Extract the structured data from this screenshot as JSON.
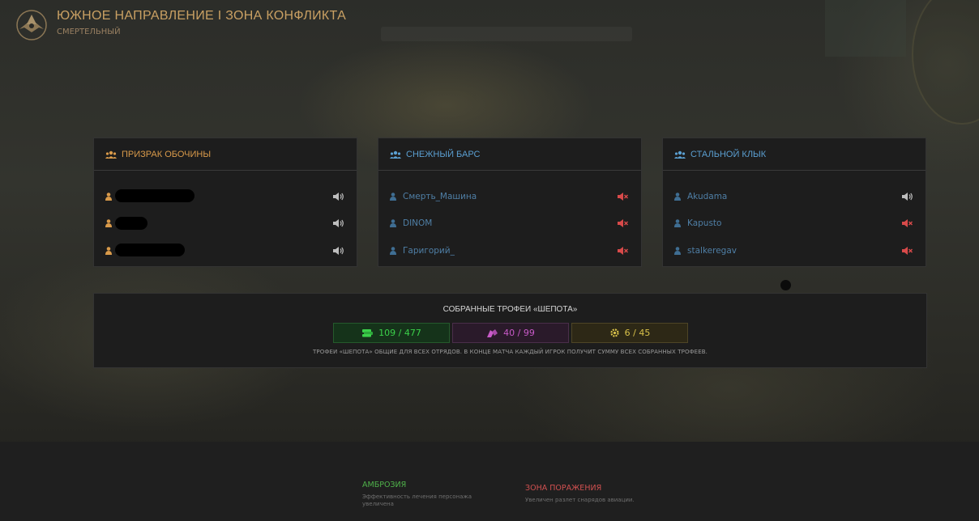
{
  "header": {
    "title": "ЮЖНОЕ НАПРАВЛЕНИЕ I ЗОНА КОНФЛИКТА",
    "subtitle": "СМЕРТЕЛЬНЫЙ"
  },
  "squads": [
    {
      "name": "ПРИЗРАК ОБОЧИНЫ",
      "color": "#d99a4a",
      "players": [
        {
          "name": "",
          "voice": "on"
        },
        {
          "name": "",
          "voice": "on"
        },
        {
          "name": "",
          "voice": "on"
        }
      ]
    },
    {
      "name": "СНЕЖНЫЙ БАРС",
      "color": "#5b9fd1",
      "players": [
        {
          "name": "Смерть_Машина",
          "voice": "muted"
        },
        {
          "name": "DINOM",
          "voice": "muted"
        },
        {
          "name": "Гаригорий_",
          "voice": "muted"
        }
      ]
    },
    {
      "name": "СТАЛЬНОЙ КЛЫК",
      "color": "#5b9fd1",
      "players": [
        {
          "name": "Akudama",
          "voice": "on"
        },
        {
          "name": "Kapusto",
          "voice": "muted"
        },
        {
          "name": "stalkeregav",
          "voice": "muted"
        }
      ]
    }
  ],
  "trophies": {
    "title": "СОБРАННЫЕ ТРОФЕИ «ШЕПОТА»",
    "items": [
      {
        "value": "109 / 477",
        "color": "#3bd14a",
        "icon": "money-icon"
      },
      {
        "value": "40 / 99",
        "color": "#c85ac8",
        "icon": "parts-icon"
      },
      {
        "value": "6 / 45",
        "color": "#d9c24a",
        "icon": "gear-icon"
      }
    ],
    "note": "ТРОФЕИ «ШЕПОТА» ОБЩИЕ ДЛЯ ВСЕХ ОТРЯДОВ. В КОНЦЕ МАТЧА КАЖДЫЙ ИГРОК ПОЛУЧИТ СУММУ ВСЕХ СОБРАННЫХ ТРОФЕЕВ."
  },
  "effects": [
    {
      "name": "АМБРОЗИЯ",
      "color": "#4fb24a",
      "desc1": "Эффективность лечения персонажа",
      "desc2": "увеличена"
    },
    {
      "name": "ЗОНА ПОРАЖЕНИЯ",
      "color": "#d05050",
      "desc1": "Увеличен разлет снарядов авиации.",
      "desc2": ""
    }
  ]
}
